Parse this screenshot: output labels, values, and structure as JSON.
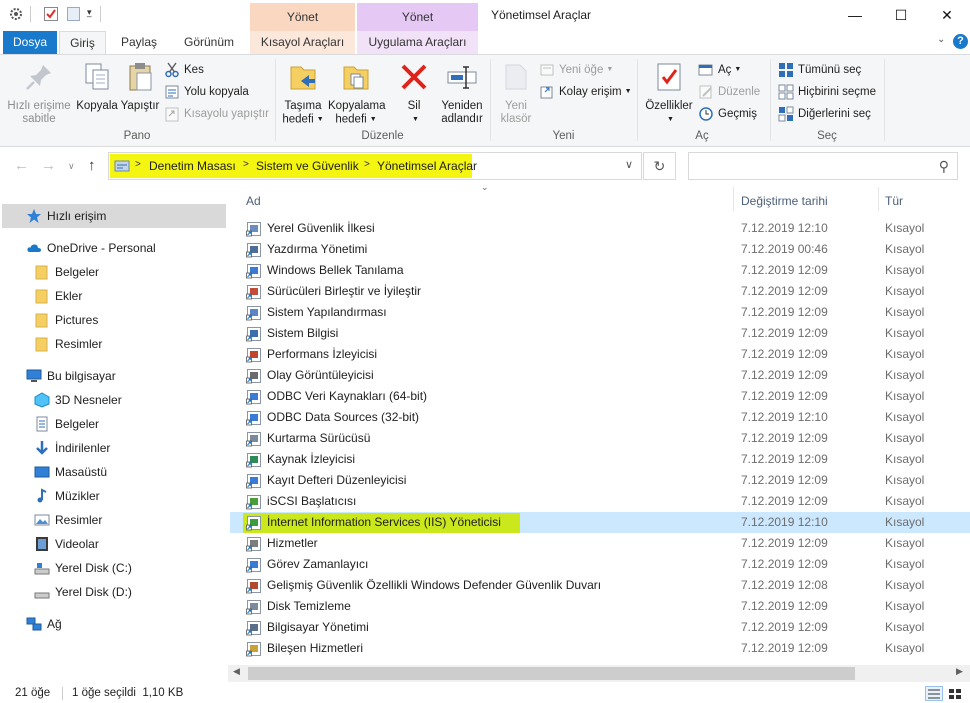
{
  "window": {
    "title": "Yönetimsel Araçlar",
    "ctx_tab_1_header": "Yönet",
    "ctx_tab_2_header": "Yönet",
    "minimize": "—",
    "maximize": "☐",
    "close": "✕"
  },
  "ribbon_tabs": {
    "dosya": "Dosya",
    "giris": "Giriş",
    "paylas": "Paylaş",
    "gorunum": "Görünüm",
    "kisayol_araclari": "Kısayol Araçları",
    "uygulama_araclari": "Uygulama Araçları"
  },
  "ribbon": {
    "pano": {
      "label": "Pano",
      "pin_1": "Hızlı erişime",
      "pin_2": "sabitle",
      "copy": "Kopyala",
      "paste": "Yapıştır",
      "cut": "Kes",
      "copy_path": "Yolu kopyala",
      "paste_shortcut": "Kısayolu yapıştır"
    },
    "duzenle": {
      "label": "Düzenle",
      "move_1": "Taşıma",
      "move_2": "hedefi",
      "copyto_1": "Kopyalama",
      "copyto_2": "hedefi",
      "delete": "Sil",
      "rename_1": "Yeniden",
      "rename_2": "adlandır"
    },
    "yeni": {
      "label": "Yeni",
      "new_folder_1": "Yeni",
      "new_folder_2": "klasör",
      "new_item": "Yeni öğe",
      "easy_access": "Kolay erişim"
    },
    "ac": {
      "label": "Aç",
      "properties": "Özellikler",
      "open": "Aç",
      "edit": "Düzenle",
      "history": "Geçmiş"
    },
    "sec": {
      "label": "Seç",
      "select_all": "Tümünü seç",
      "select_none": "Hiçbirini seçme",
      "invert": "Diğerlerini seç"
    }
  },
  "address": {
    "crumbs": [
      "Denetim Masası",
      "Sistem ve Güvenlik",
      "Yönetimsel Araçlar"
    ],
    "search_placeholder": ""
  },
  "nav": {
    "quick_access": "Hızlı erişim",
    "onedrive": "OneDrive - Personal",
    "onedrive_items": [
      "Belgeler",
      "Ekler",
      "Pictures",
      "Resimler"
    ],
    "this_pc": "Bu bilgisayar",
    "pc_items": [
      "3D Nesneler",
      "Belgeler",
      "İndirilenler",
      "Masaüstü",
      "Müzikler",
      "Resimler",
      "Videolar",
      "Yerel Disk (C:)",
      "Yerel Disk (D:)"
    ],
    "network": "Ağ"
  },
  "columns": {
    "name": "Ad",
    "date": "Değiştirme tarihi",
    "type": "Tür"
  },
  "files": [
    {
      "name": "Yerel Güvenlik İlkesi",
      "date": "7.12.2019 12:10",
      "type": "Kısayol",
      "icon": "security-policy-icon"
    },
    {
      "name": "Yazdırma Yönetimi",
      "date": "7.12.2019 00:46",
      "type": "Kısayol",
      "icon": "print-management-icon"
    },
    {
      "name": "Windows Bellek Tanılama",
      "date": "7.12.2019 12:09",
      "type": "Kısayol",
      "icon": "memory-diagnostic-icon"
    },
    {
      "name": "Sürücüleri Birleştir ve İyileştir",
      "date": "7.12.2019 12:09",
      "type": "Kısayol",
      "icon": "defrag-icon"
    },
    {
      "name": "Sistem Yapılandırması",
      "date": "7.12.2019 12:09",
      "type": "Kısayol",
      "icon": "system-config-icon"
    },
    {
      "name": "Sistem Bilgisi",
      "date": "7.12.2019 12:09",
      "type": "Kısayol",
      "icon": "system-info-icon"
    },
    {
      "name": "Performans İzleyicisi",
      "date": "7.12.2019 12:09",
      "type": "Kısayol",
      "icon": "performance-monitor-icon"
    },
    {
      "name": "Olay Görüntüleyicisi",
      "date": "7.12.2019 12:09",
      "type": "Kısayol",
      "icon": "event-viewer-icon"
    },
    {
      "name": "ODBC Veri Kaynakları (64-bit)",
      "date": "7.12.2019 12:09",
      "type": "Kısayol",
      "icon": "odbc-icon"
    },
    {
      "name": "ODBC Data Sources (32-bit)",
      "date": "7.12.2019 12:10",
      "type": "Kısayol",
      "icon": "odbc-icon"
    },
    {
      "name": "Kurtarma Sürücüsü",
      "date": "7.12.2019 12:09",
      "type": "Kısayol",
      "icon": "recovery-drive-icon"
    },
    {
      "name": "Kaynak İzleyicisi",
      "date": "7.12.2019 12:09",
      "type": "Kısayol",
      "icon": "resource-monitor-icon"
    },
    {
      "name": "Kayıt Defteri Düzenleyicisi",
      "date": "7.12.2019 12:09",
      "type": "Kısayol",
      "icon": "registry-editor-icon"
    },
    {
      "name": "iSCSI Başlatıcısı",
      "date": "7.12.2019 12:09",
      "type": "Kısayol",
      "icon": "iscsi-icon"
    },
    {
      "name": "İnternet Information Services (IIS) Yöneticisi",
      "date": "7.12.2019 12:10",
      "type": "Kısayol",
      "icon": "iis-manager-icon",
      "selected": true
    },
    {
      "name": "Hizmetler",
      "date": "7.12.2019 12:09",
      "type": "Kısayol",
      "icon": "services-icon"
    },
    {
      "name": "Görev Zamanlayıcı",
      "date": "7.12.2019 12:09",
      "type": "Kısayol",
      "icon": "task-scheduler-icon"
    },
    {
      "name": "Gelişmiş Güvenlik Özellikli Windows Defender Güvenlik Duvarı",
      "date": "7.12.2019 12:08",
      "type": "Kısayol",
      "icon": "firewall-icon"
    },
    {
      "name": "Disk Temizleme",
      "date": "7.12.2019 12:09",
      "type": "Kısayol",
      "icon": "disk-cleanup-icon"
    },
    {
      "name": "Bilgisayar Yönetimi",
      "date": "7.12.2019 12:09",
      "type": "Kısayol",
      "icon": "computer-management-icon"
    },
    {
      "name": "Bileşen Hizmetleri",
      "date": "7.12.2019 12:09",
      "type": "Kısayol",
      "icon": "component-services-icon"
    }
  ],
  "status": {
    "item_count": "21 öğe",
    "selection": "1 öğe seçildi  1,10 KB"
  },
  "colors": {
    "accent": "#1979ca",
    "highlight": "#f4f511",
    "selection_highlight": "#cbe81c",
    "selection_row": "#cce8ff"
  }
}
